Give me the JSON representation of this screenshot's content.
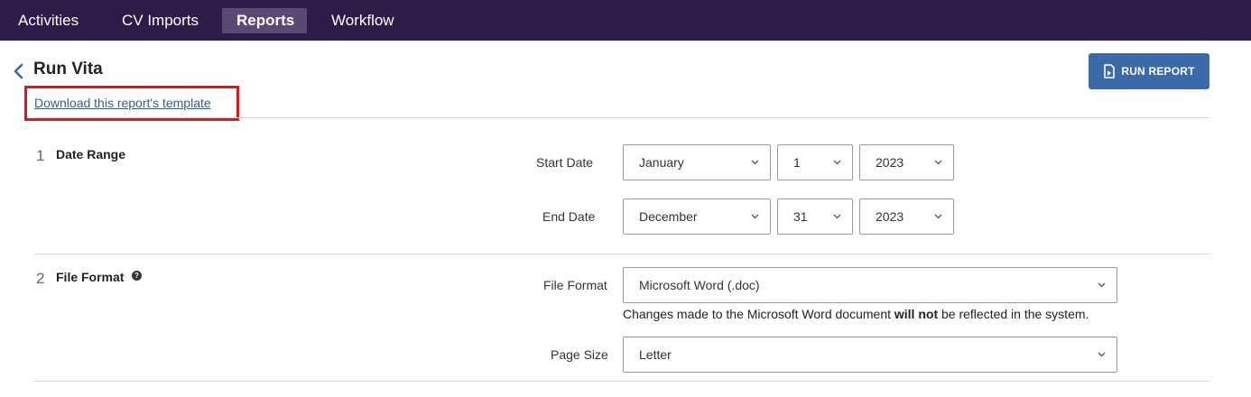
{
  "nav": {
    "items": [
      {
        "label": "Activities",
        "active": false
      },
      {
        "label": "CV Imports",
        "active": false
      },
      {
        "label": "Reports",
        "active": true
      },
      {
        "label": "Workflow",
        "active": false
      }
    ]
  },
  "header": {
    "title": "Run Vita",
    "template_link": "Download this report's template",
    "run_button": "RUN REPORT"
  },
  "sections": {
    "date_range": {
      "number": "1",
      "title": "Date Range",
      "start_label": "Start Date",
      "start_month": "January",
      "start_day": "1",
      "start_year": "2023",
      "end_label": "End Date",
      "end_month": "December",
      "end_day": "31",
      "end_year": "2023"
    },
    "file_format": {
      "number": "2",
      "title": "File Format",
      "help_glyph": "?",
      "format_label": "File Format",
      "format_value": "Microsoft Word (.doc)",
      "note_before": "Changes made to the Microsoft Word document ",
      "note_bold": "will not",
      "note_after": " be reflected in the system.",
      "page_size_label": "Page Size",
      "page_size_value": "Letter"
    }
  },
  "colors": {
    "nav_bg": "#2e1b47",
    "nav_active": "#5a4a73",
    "primary_button": "#3b6aa8",
    "link": "#3a5b8c",
    "highlight_box": "#e0161d"
  }
}
